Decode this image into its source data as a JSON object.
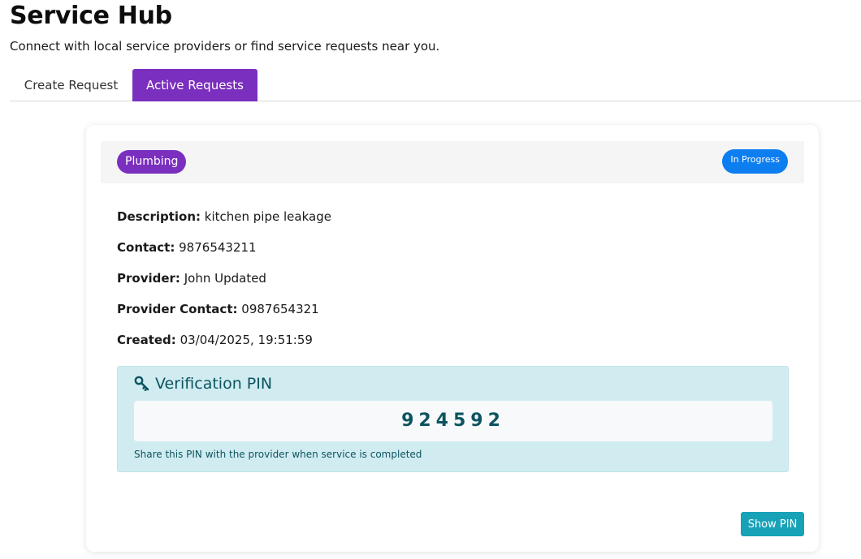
{
  "header": {
    "title": "Service Hub",
    "subtitle": "Connect with local service providers or find service requests near you."
  },
  "tabs": [
    {
      "label": "Create Request",
      "active": false
    },
    {
      "label": "Active Requests",
      "active": true
    }
  ],
  "request": {
    "category": "Plumbing",
    "status": "In Progress",
    "fields": [
      {
        "label": "Description:",
        "value": "kitchen pipe leakage"
      },
      {
        "label": "Contact:",
        "value": "9876543211"
      },
      {
        "label": "Provider:",
        "value": "John Updated"
      },
      {
        "label": "Provider Contact:",
        "value": "0987654321"
      },
      {
        "label": "Created:",
        "value": "03/04/2025, 19:51:59"
      }
    ],
    "pin": {
      "title": "Verification PIN",
      "icon": "key-icon",
      "value": "924592",
      "hint": "Share this PIN with the provider when service is completed"
    },
    "show_pin_label": "Show PIN"
  },
  "colors": {
    "primary": "#7b2fbe",
    "status": "#0d7ef0",
    "info_bg": "#d1ecf1",
    "info_text": "#0c5460",
    "button": "#17a2b8"
  }
}
